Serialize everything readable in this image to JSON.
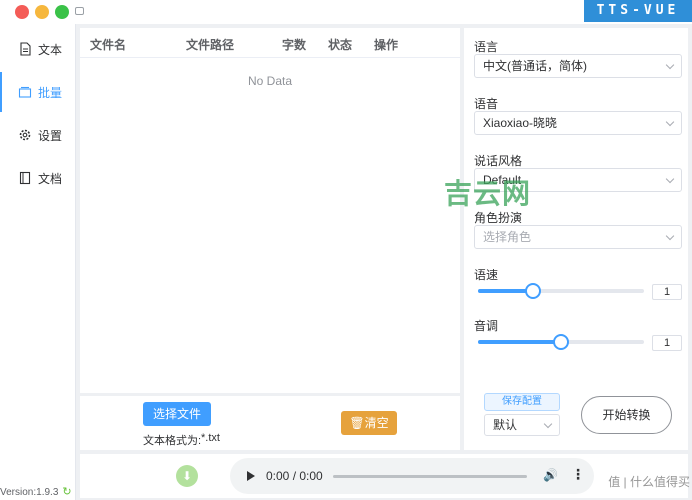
{
  "app": {
    "brand": "TTS-VUE"
  },
  "sidebar": {
    "items": [
      {
        "label": "文本",
        "icon": "document-icon"
      },
      {
        "label": "批量",
        "icon": "folder-icon"
      },
      {
        "label": "设置",
        "icon": "gear-icon"
      },
      {
        "label": "文档",
        "icon": "book-icon"
      }
    ],
    "version": "Version:1.9.3"
  },
  "table": {
    "columns": [
      "文件名",
      "文件路径",
      "字数",
      "状态",
      "操作"
    ],
    "empty_text": "No Data"
  },
  "actions": {
    "select_file_label": "选择文件",
    "format_label": "文本格式为:",
    "format_value": "*.txt",
    "clear_label": "清空"
  },
  "config": {
    "language_label": "语言",
    "language_value": "中文(普通话，简体)",
    "voice_label": "语音",
    "voice_value": "Xiaoxiao-晓晓",
    "style_label": "说话风格",
    "style_value": "Default",
    "role_label": "角色扮演",
    "role_placeholder": "选择角色",
    "rate_label": "语速",
    "rate_value": "1",
    "rate_fraction": 0.33,
    "pitch_label": "音调",
    "pitch_value": "1",
    "pitch_fraction": 0.5,
    "save_config_label": "保存配置",
    "preset_value": "默认",
    "start_label": "开始转换"
  },
  "player": {
    "time": "0:00 / 0:00"
  },
  "watermark": {
    "text": "吉云网"
  },
  "corner_mark": {
    "text": "值 | 什么值得买"
  },
  "colors": {
    "primary": "#409eff",
    "warning": "#e6a23c",
    "success": "#67c23a",
    "brand": "#2f8fd8"
  }
}
